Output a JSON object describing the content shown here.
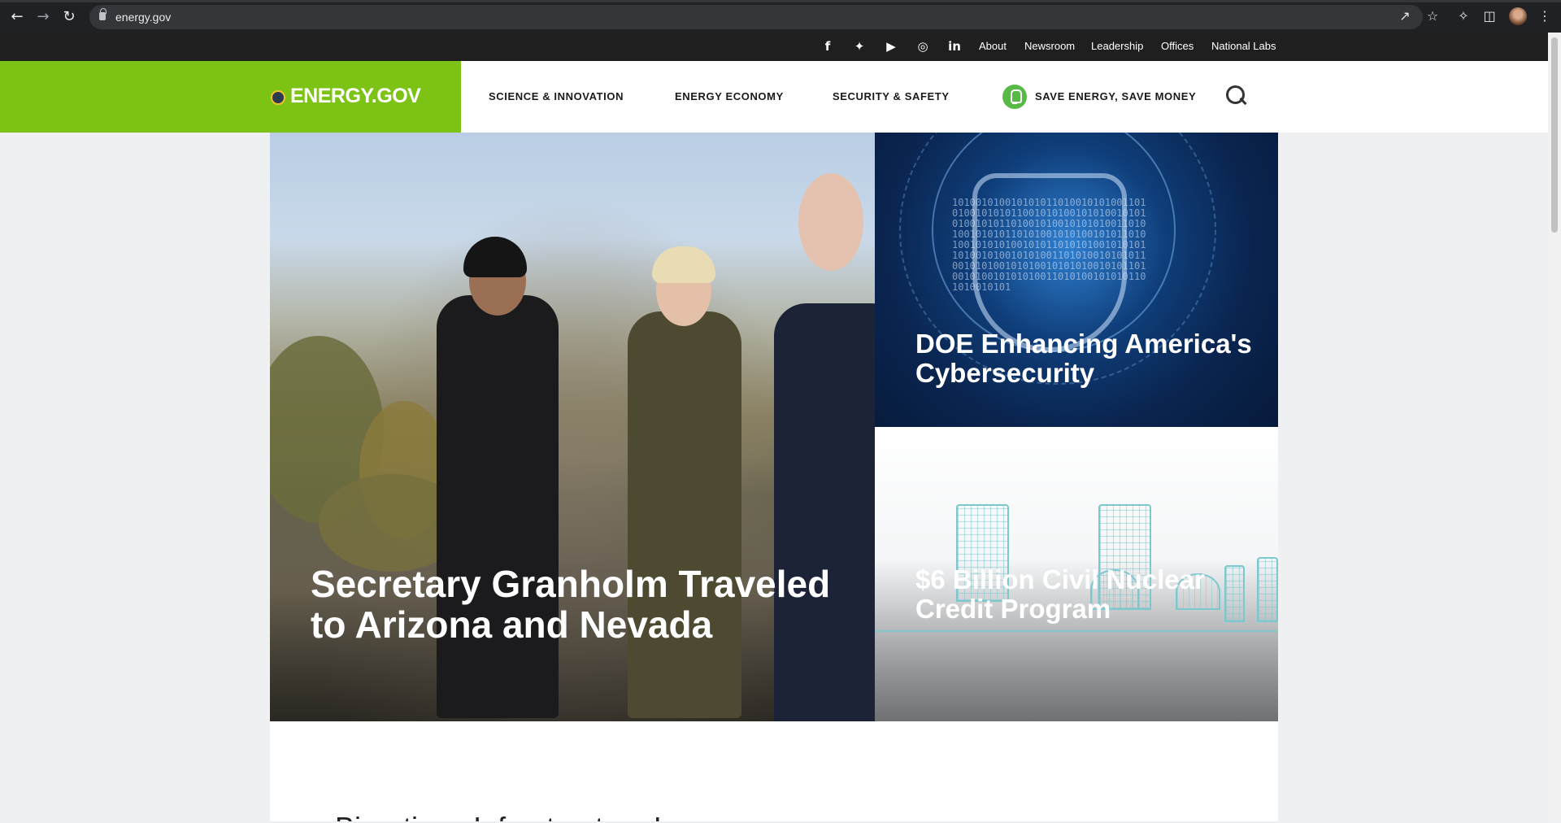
{
  "browser": {
    "url": "energy.gov"
  },
  "utility_nav": {
    "social": [
      "facebook-icon",
      "twitter-icon",
      "youtube-icon",
      "instagram-icon",
      "linkedin-icon"
    ],
    "links": [
      "About",
      "Newsroom",
      "Leadership",
      "Offices",
      "National Labs"
    ]
  },
  "header": {
    "logo": "ENERGY.GOV",
    "nav": [
      "SCIENCE & INNOVATION",
      "ENERGY ECONOMY",
      "SECURITY & SAFETY",
      "SAVE ENERGY, SAVE MONEY"
    ]
  },
  "hero": {
    "main_title": "Secretary Granholm Traveled to Arizona and Nevada",
    "cyber_title": "DOE Enhancing America's Cybersecurity",
    "nuclear_title": "$6 Billion Civil Nuclear Credit Program",
    "binary_text": "1010010100101010110100101010011010100101010110010101001010100101010100101011010010100101010100110101001010101101010010101001010110101001010101001010110101010010101011010010100101010011010100101010110010101001010100101010100101011010010100101010100110101001010101101010010101"
  },
  "main": {
    "section_heading": "Bipartisan Infrastructure Law"
  },
  "colors": {
    "brand_green": "#7cc316",
    "utility_bar": "#1f1f1f",
    "bulb_green": "#58b947"
  }
}
